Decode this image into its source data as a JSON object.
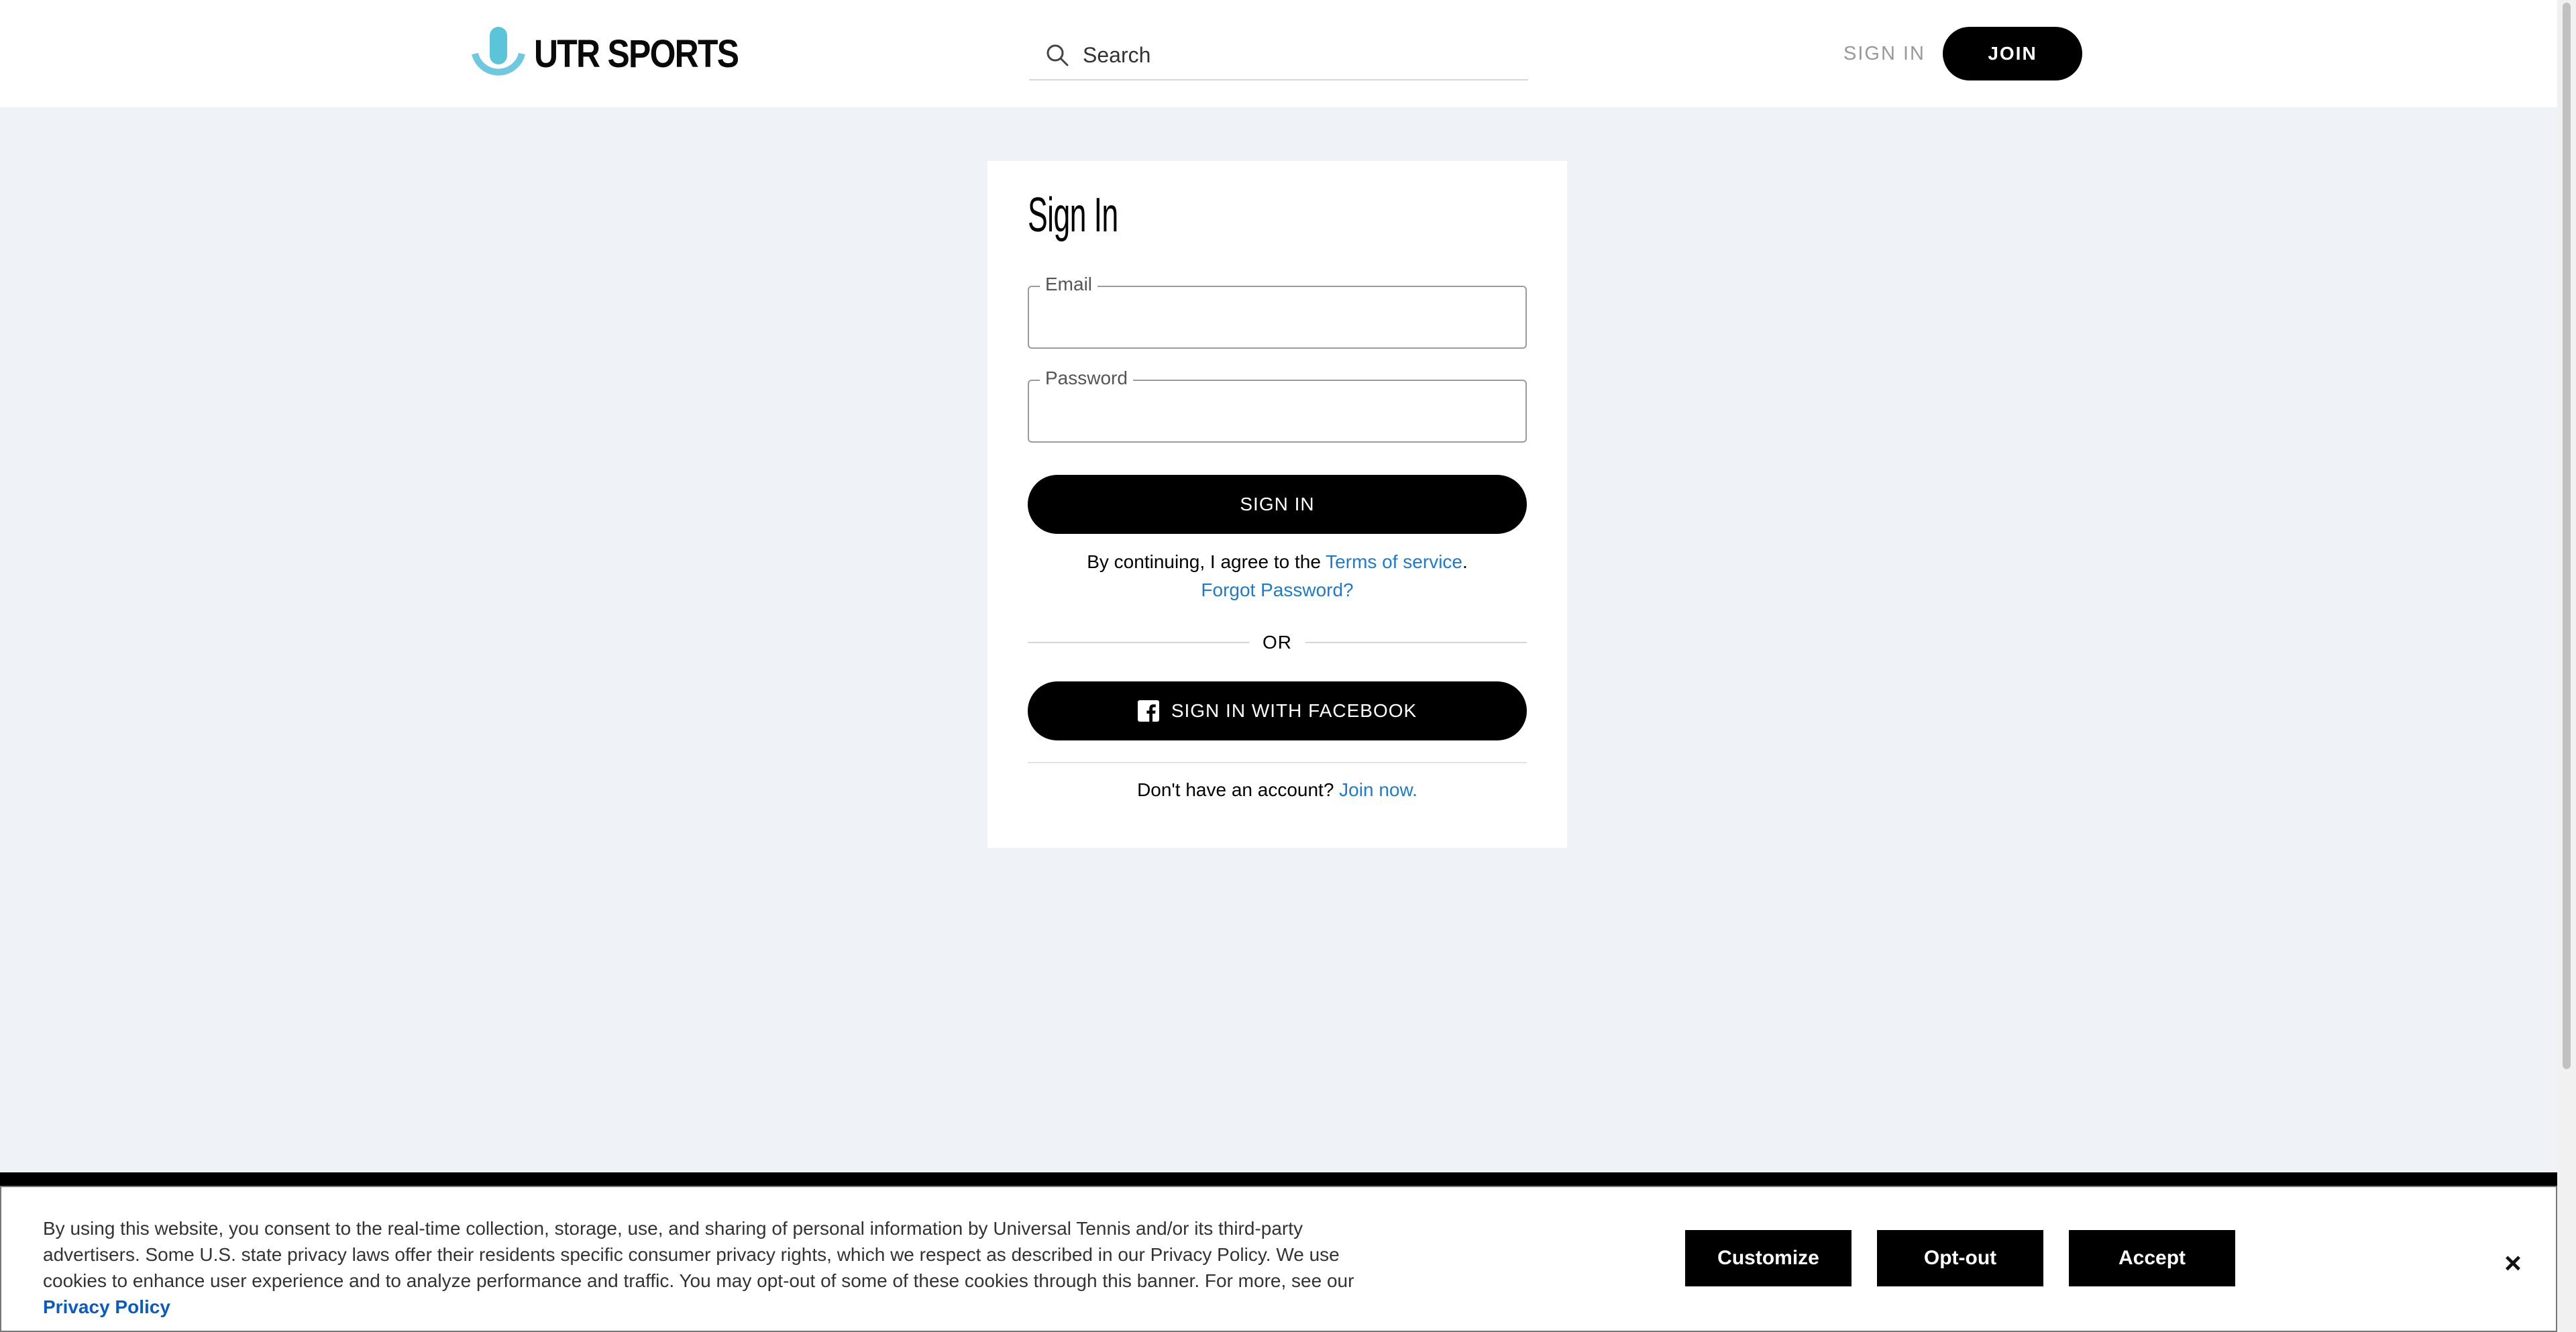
{
  "header": {
    "logo_text": "UTR SPORTS",
    "search_placeholder": "Search",
    "signin_label": "SIGN IN",
    "join_label": "JOIN"
  },
  "signin_card": {
    "title": "Sign In",
    "email_label": "Email",
    "email_value": "",
    "password_label": "Password",
    "password_value": "",
    "signin_button": "SIGN IN",
    "agree_prefix": "By continuing, I agree to the ",
    "terms_link": "Terms of service",
    "agree_suffix": ".",
    "forgot_password": "Forgot Password?",
    "or_text": "OR",
    "facebook_button": "SIGN IN WITH FACEBOOK",
    "no_account_text": "Don't have an account? ",
    "join_link": "Join now."
  },
  "cookie_banner": {
    "text": "By using this website, you consent to the real-time collection, storage, use, and sharing of personal information by Universal Tennis and/or its third-party advertisers. Some U.S. state privacy laws offer their residents specific consumer privacy rights, which we respect as described in our Privacy Policy. We use cookies to enhance user experience and to analyze performance and traffic. You may opt-out of some of these cookies through this banner. For more, see our ",
    "policy_link": "Privacy Policy",
    "customize_label": "Customize",
    "optout_label": "Opt-out",
    "accept_label": "Accept",
    "close_glyph": "×"
  },
  "colors": {
    "page_bg": "#eff2f7",
    "link": "#1c7bd1",
    "logo_teal": "#5bc4d9",
    "logo_blue": "#2a9fd6"
  },
  "icons": {
    "logo": "utr-logo-icon",
    "search": "search-icon",
    "facebook": "facebook-icon",
    "close": "close-icon"
  }
}
